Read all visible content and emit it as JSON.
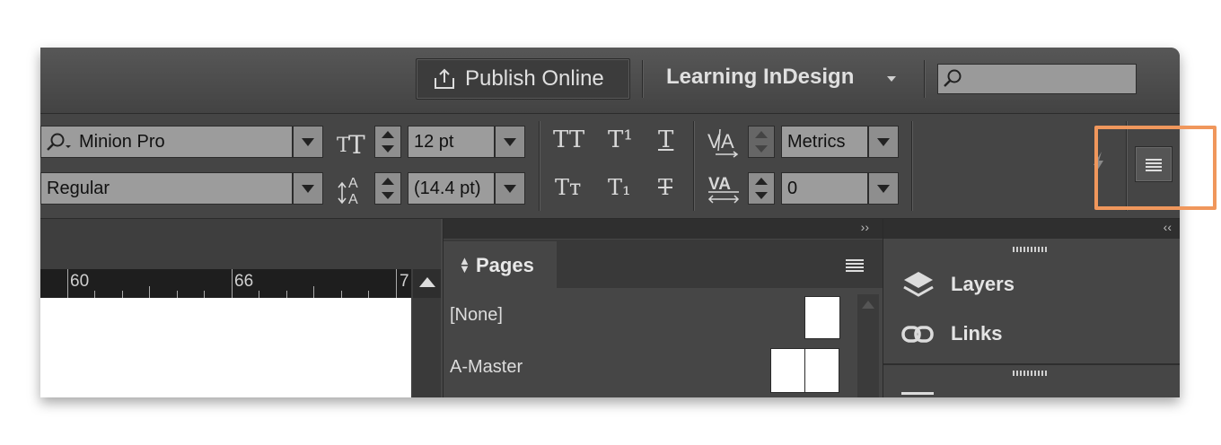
{
  "header": {
    "publish_label": "Publish Online",
    "workspace_label": "Learning InDesign",
    "search_placeholder": ""
  },
  "control_panel": {
    "font_family": "Minion Pro",
    "font_style": "Regular",
    "font_size": "12 pt",
    "leading": "(14.4 pt)",
    "kerning": "Metrics",
    "tracking": "0",
    "char_buttons_row1": [
      "TT",
      "T¹",
      "T"
    ],
    "char_buttons_row2": [
      "Tт",
      "T₁",
      "T"
    ]
  },
  "ruler": {
    "labels": [
      "60",
      "66",
      "7"
    ]
  },
  "pages_panel": {
    "tab_label": "Pages",
    "items": [
      "[None]",
      "A-Master"
    ]
  },
  "right_panel": {
    "items": [
      "Layers",
      "Links"
    ]
  },
  "colors": {
    "highlight": "#f0975c",
    "panel_bg": "#464646"
  }
}
